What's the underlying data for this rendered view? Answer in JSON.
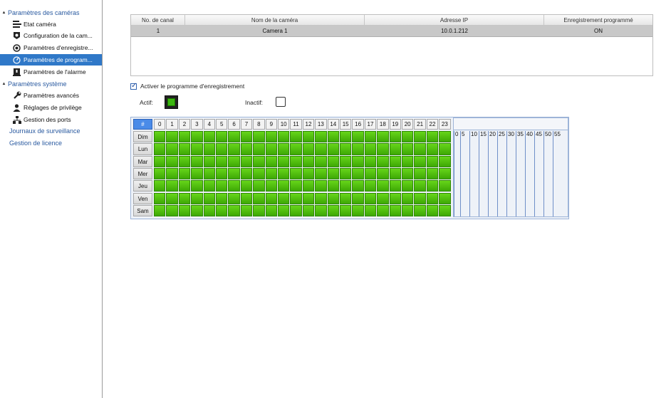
{
  "sidebar": {
    "group_cameras": "Paramètres des caméras",
    "camera_items": [
      {
        "label": "Etat caméra",
        "icon": "status-icon"
      },
      {
        "label": "Configuration de la cam...",
        "icon": "camera-config-icon"
      },
      {
        "label": "Paramètres d'enregistre...",
        "icon": "record-icon"
      },
      {
        "label": "Paramètres de program...",
        "icon": "clock-icon",
        "selected": true
      },
      {
        "label": "Paramètres de l'alarme",
        "icon": "alarm-icon"
      }
    ],
    "group_system": "Paramètres système",
    "system_items": [
      {
        "label": "Paramètres avancés",
        "icon": "wrench-icon"
      },
      {
        "label": "Réglages de privilège",
        "icon": "user-icon"
      },
      {
        "label": "Gestion des ports",
        "icon": "network-icon"
      }
    ],
    "link_logs": "Journaux de surveillance",
    "link_license": "Gestion de licence"
  },
  "camera_table": {
    "columns": [
      "No. de canal",
      "Nom de la caméra",
      "Adresse IP",
      "Enregistrement programmé"
    ],
    "rows": [
      {
        "channel": "1",
        "name": "Camera 1",
        "ip": "10.0.1.212",
        "scheduled": "ON"
      }
    ]
  },
  "enable_schedule": {
    "label": "Activer le programme d'enregistrement",
    "checked": true
  },
  "legend": {
    "active_label": "Actif:",
    "inactive_label": "Inactif:"
  },
  "schedule": {
    "corner": "#",
    "hours": [
      "0",
      "1",
      "2",
      "3",
      "4",
      "5",
      "6",
      "7",
      "8",
      "9",
      "10",
      "11",
      "12",
      "13",
      "14",
      "15",
      "16",
      "17",
      "18",
      "19",
      "20",
      "21",
      "22",
      "23"
    ],
    "days": [
      "Dim",
      "Lun",
      "Mar",
      "Mer",
      "Jeu",
      "Ven",
      "Sam"
    ],
    "active_fraction": 1.0,
    "minutes": [
      "0",
      "5",
      "10",
      "15",
      "20",
      "25",
      "30",
      "35",
      "40",
      "45",
      "50",
      "55"
    ]
  },
  "colors": {
    "accent": "#2f78c8",
    "active": "#4fc00f",
    "link": "#2a5aa0"
  }
}
